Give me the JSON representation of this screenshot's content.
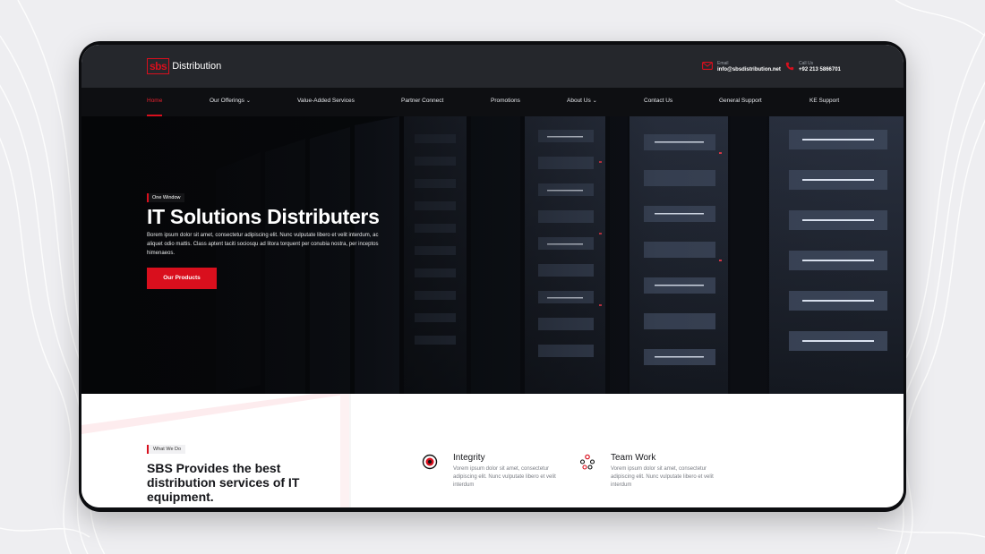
{
  "brand": {
    "logo_mark": "sbs",
    "logo_text": "Distribution",
    "accent": "#d90f1d"
  },
  "header": {
    "email": {
      "label": "Email",
      "value": "info@sbsdistribution.net",
      "icon": "mail-icon"
    },
    "call": {
      "label": "Call Us",
      "value": "+92 213 5866701",
      "icon": "phone-icon"
    }
  },
  "nav": {
    "items": [
      {
        "label": "Home",
        "active": true
      },
      {
        "label": "Our Offerings",
        "dropdown": true
      },
      {
        "label": "Value-Added Services"
      },
      {
        "label": "Partner Connect"
      },
      {
        "label": "Promotions"
      },
      {
        "label": "About Us",
        "dropdown": true
      },
      {
        "label": "Contact Us"
      },
      {
        "label": "General Support"
      },
      {
        "label": "KE Support"
      }
    ],
    "chevron": "⌄"
  },
  "hero": {
    "eyebrow": "One Window",
    "title": "IT Solutions Distributers",
    "description": "Borem ipsum dolor sit amet, consectetur adipiscing elit. Nunc vulputate libero et velit interdum, ac aliquet odio mattis. Class aptent taciti sociosqu ad litora torquent per conubia nostra, per inceptos himenaeos.",
    "cta": "Our Products"
  },
  "about": {
    "tag": "What We Do",
    "title": "SBS Provides the best distribution services of IT equipment."
  },
  "features": [
    {
      "title": "Integrity",
      "description": "Vorem ipsum dolor sit amet, consectetur adipiscing elit. Nunc vulputate libero et velit interdum",
      "icon": "target-icon"
    },
    {
      "title": "Team Work",
      "description": "Vorem ipsum dolor sit amet, consectetur adipiscing elit. Nunc vulputate libero et velit interdum",
      "icon": "team-icon"
    }
  ]
}
